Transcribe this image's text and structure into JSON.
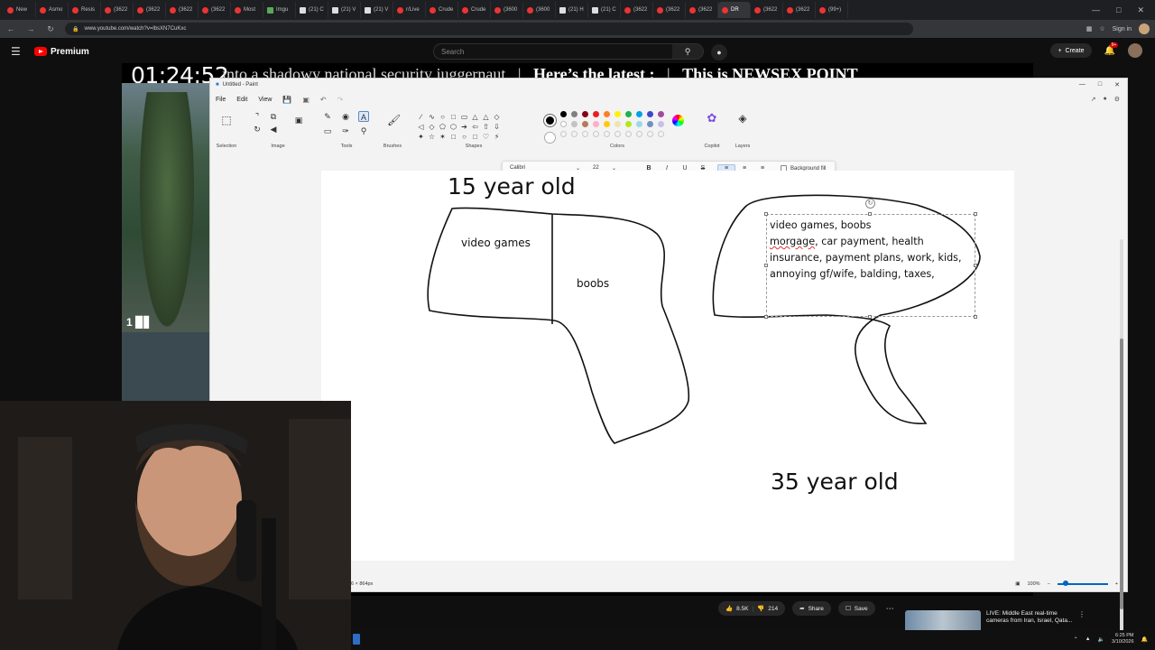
{
  "browser": {
    "tabs": [
      "New",
      "Asmo",
      "Resis",
      "(3622",
      "(3622",
      "(3622",
      "(3622",
      "Most",
      "Imgu",
      "(21) C",
      "(21) V",
      "(21) V",
      "r/Live",
      "Crude",
      "Crude",
      "(3600",
      "(3600",
      "(21) H",
      "(21) C",
      "(3622",
      "(3622",
      "(3622",
      "DR",
      "(3622",
      "(3622",
      "(99+)"
    ],
    "active_tab_index": 22,
    "url": "www.youtube.com/watch?v=lbsXN7CuKxc",
    "sign_in": "Sign in"
  },
  "youtube": {
    "logo": "Premium",
    "search_placeholder": "Search",
    "create": "Create",
    "notif_count": "9+",
    "likes": "8.5K",
    "dislikes": "214",
    "share": "Share",
    "save": "Save",
    "rec_title": "LIVE: Middle East real-time cameras from Iran, Israel, Qata..."
  },
  "stream": {
    "timer": "01:24:52",
    "ticker_prefix": "into a shadowy national security juggernaut",
    "ticker_latest": "Here’s the latest :",
    "ticker_this_is": "This is",
    "ticker_brand": "NEWSEX POINT",
    "stat": "1"
  },
  "paint": {
    "title": "Untitled - Paint",
    "menu": [
      "File",
      "Edit",
      "View"
    ],
    "groups": [
      "Selection",
      "Image",
      "Tools",
      "Brushes",
      "Shapes",
      "Colors",
      "Copilot",
      "Layers"
    ],
    "font": "Calibri",
    "font_size": "22",
    "bgfill_label": "Background fill",
    "status_size": "6 × 864px",
    "zoom": "100%",
    "colors": {
      "row1": [
        "#000000",
        "#7f7f7f",
        "#880015",
        "#ed1c24",
        "#ff7f27",
        "#fff200",
        "#22b14c",
        "#00a2e8",
        "#3f48cc",
        "#a349a4"
      ],
      "row2": [
        "#ffffff",
        "#c3c3c3",
        "#b97a57",
        "#ffaec9",
        "#ffc90e",
        "#efe4b0",
        "#b5e61d",
        "#99d9ea",
        "#7092be",
        "#c8bfe7"
      ]
    }
  },
  "canvas": {
    "label_15": "15 year old",
    "label_35": "35 year old",
    "left_part_a": "video games",
    "left_part_b": "boobs",
    "right_text": [
      "video games, boobs",
      "car payment, health",
      "insurance, payment plans, work, kids,",
      "annoying gf/wife, balding, taxes,"
    ],
    "right_text_misspelled": "morgage"
  },
  "taskbar": {
    "time": "6:25 PM",
    "date": "3/10/2026"
  }
}
